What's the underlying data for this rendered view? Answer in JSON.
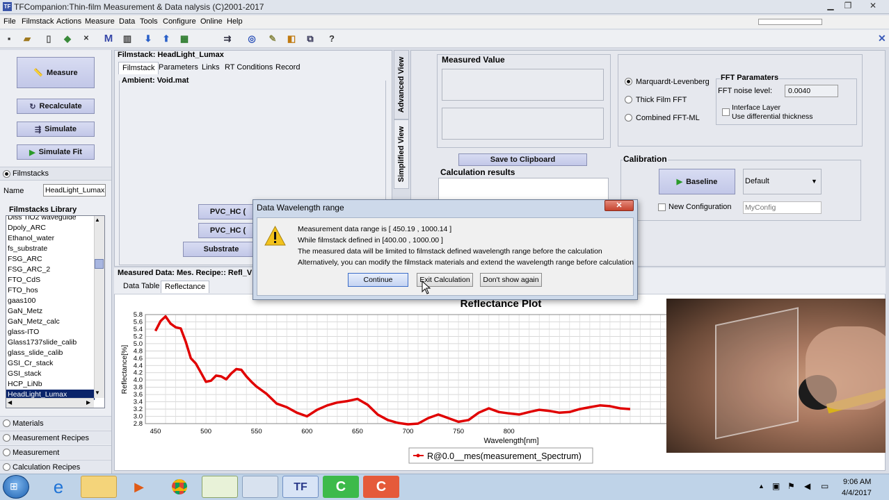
{
  "app": {
    "title": "TFCompanion:Thin-film Measurement & Data nalysis (C)2001-2017"
  },
  "menu": [
    "File",
    "Filmstack",
    "Actions",
    "Measure",
    "Data",
    "Tools",
    "Configure",
    "Online",
    "Help"
  ],
  "left": {
    "measure": "Measure",
    "recalculate": "Recalculate",
    "simulate": "Simulate",
    "simulate_fit": "Simulate Fit",
    "filmstacks": "Filmstacks",
    "name_label": "Name",
    "name_value": "HeadLight_Lumax",
    "library_title": "Filmstacks Library",
    "library_items": [
      "Diss TiO2 waveguide",
      "Dpoly_ARC",
      "Ethanol_water",
      "fs_substrate",
      "FSG_ARC",
      "FSG_ARC_2",
      "FTO_CdS",
      "FTO_hos",
      "gaas100",
      "GaN_Metz",
      "GaN_Metz_calc",
      "glass-ITO",
      "Glass1737slide_calib",
      "glass_slide_calib",
      "GSI_Cr_stack",
      "GSI_stack",
      "HCP_LiNb",
      "HeadLight_Lumax"
    ],
    "accordion": [
      "Materials",
      "Measurement Recipes",
      "Measurement",
      "Calculation Recipes"
    ]
  },
  "filmstack": {
    "title": "Filmstack: HeadLight_Lumax",
    "tabs": [
      "Filmstack",
      "Parameters",
      "Links",
      "RT Conditions",
      "Record"
    ],
    "ambient": "Ambient: Void.mat",
    "layer1": "PVC_HC (",
    "layer2": "PVC_HC (",
    "substrate": "Substrate",
    "vtab_advanced": "Advanced View",
    "vtab_simplified": "Simplified View"
  },
  "measured": {
    "title": "Measured Value",
    "save": "Save to Clipboard",
    "calc_results": "Calculation results"
  },
  "fit": {
    "options": [
      "Marquardt-Levenberg",
      "Thick Film FFT",
      "Combined FFT-ML"
    ],
    "fft_title": "FFT Paramaters",
    "fft_noise_label": "FFT noise level:",
    "fft_noise_value": "0.0040",
    "interface_layer": "Interface Layer",
    "use_diff": "Use differential thickness"
  },
  "calibration": {
    "title": "Calibration",
    "baseline": "Baseline",
    "default": "Default",
    "new_config": "New Configuration",
    "config_placeholder": "MyConfig"
  },
  "measured_data": {
    "title": "Measured Data: Mes. Recipe:: Refl_V",
    "tabs": [
      "Data Table",
      "Reflectance"
    ]
  },
  "dialog": {
    "title": "Data Wavelength range",
    "lines": [
      "Measurement data range is [ 450.19 , 1000.14 ]",
      "While filmstack defined in [400.00 , 1000.00 ]",
      "The measured data will be limited to filmstack defined wavelength range before the calculation",
      "Alternatively, you can modify the filmstack materials and extend the wavelength range before calculation"
    ],
    "continue": "Continue",
    "exit": "Exit Calculation",
    "dont_show": "Don't show again"
  },
  "chart_data": {
    "type": "line",
    "title": "Reflectance Plot",
    "xlabel": "Wavelength[nm]",
    "ylabel": "Reflectance[%]",
    "xlim": [
      440,
      960
    ],
    "ylim": [
      2.8,
      5.8
    ],
    "xticks": [
      "450",
      "500",
      "550",
      "600",
      "650",
      "700",
      "750",
      "800"
    ],
    "yticks": [
      "2.8",
      "3.0",
      "3.2",
      "3.4",
      "3.6",
      "3.8",
      "4.0",
      "4.2",
      "4.4",
      "4.6",
      "4.8",
      "5.0",
      "5.2",
      "5.4",
      "5.6",
      "5.8"
    ],
    "legend": "R@0.0__mes(measurement_Spectrum)",
    "series_color": "#e00000",
    "x": [
      450,
      455,
      460,
      465,
      470,
      475,
      480,
      485,
      490,
      495,
      500,
      505,
      510,
      515,
      520,
      525,
      530,
      535,
      540,
      545,
      550,
      560,
      570,
      580,
      590,
      600,
      610,
      620,
      630,
      640,
      650,
      660,
      670,
      680,
      690,
      700,
      710,
      720,
      730,
      740,
      750,
      760,
      770,
      780,
      790,
      800,
      810,
      820,
      830,
      840,
      850,
      860,
      870,
      880,
      890,
      900,
      910,
      920
    ],
    "y": [
      5.35,
      5.62,
      5.75,
      5.55,
      5.45,
      5.42,
      5.05,
      4.6,
      4.45,
      4.2,
      3.95,
      3.98,
      4.12,
      4.1,
      4.02,
      4.18,
      4.3,
      4.28,
      4.1,
      3.95,
      3.82,
      3.62,
      3.35,
      3.25,
      3.1,
      3.0,
      3.18,
      3.3,
      3.38,
      3.42,
      3.48,
      3.32,
      3.05,
      2.9,
      2.82,
      2.78,
      2.8,
      2.95,
      3.05,
      2.95,
      2.85,
      2.9,
      3.1,
      3.22,
      3.12,
      3.08,
      3.05,
      3.12,
      3.18,
      3.15,
      3.1,
      3.12,
      3.2,
      3.25,
      3.3,
      3.28,
      3.22,
      3.2
    ]
  },
  "clock": {
    "time": "9:06 AM",
    "date": "4/4/2017"
  }
}
